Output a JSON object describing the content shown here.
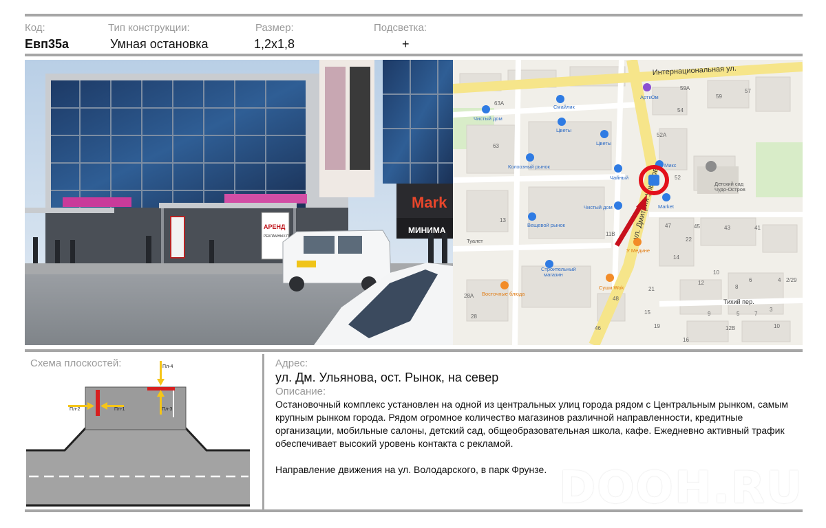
{
  "header": {
    "code_label": "Код:",
    "code_value": "Евп35а",
    "type_label": "Тип конструкции:",
    "type_value": "Умная остановка",
    "size_label": "Размер:",
    "size_value": "1,2х1,8",
    "light_label": "Подсветка:",
    "light_value": "+"
  },
  "photo": {
    "signs": {
      "market": "Mark",
      "minimum": "МИНИМА",
      "arenda": "АРЕНД",
      "arenda_sub": "РЕКЛАМНЫХ ПЛОСКОС"
    }
  },
  "map": {
    "streets": {
      "international": "Интернациональная ул.",
      "ulyanova": "ул. Дмитрия Ульянова",
      "tikhiy": "Тихий пер."
    },
    "places": {
      "artkom": "АрткОм",
      "smaylik": "Смайлик",
      "chisty_dom_1": "Чистый дом",
      "tsvety_1": "Цветы",
      "tsvety_2": "Цветы",
      "kolkhozny": "Колхозный рынок",
      "chayny": "Чайный",
      "miks": "Микс",
      "market": "Market",
      "detsad_1": "Детский сад",
      "detsad_2": "Чудо-Остров",
      "chisty_dom_2": "Чистый дом",
      "veshchevoy": "Вещевой рынок",
      "tualet": "Туалет",
      "u_medine": "У Медине",
      "stroitelny_1": "Строительный",
      "stroitelny_2": "магазин",
      "sushi": "Суши Wok",
      "vostochnye": "Восточные блюда"
    },
    "numbers": [
      "63А",
      "63",
      "59А",
      "59",
      "57",
      "54",
      "52А",
      "52",
      "13",
      "11В",
      "47",
      "45",
      "43",
      "41",
      "22",
      "14",
      "10",
      "12",
      "8",
      "6",
      "4",
      "2/29",
      "21",
      "48",
      "28А",
      "28",
      "19",
      "9",
      "5",
      "3",
      "10",
      "12В",
      "16",
      "46",
      "15",
      "7"
    ]
  },
  "schema": {
    "title": "Схема плоскостей:",
    "labels": {
      "pl1": "Пл-1",
      "pl2": "Пл-2",
      "pl3": "Пл-3",
      "pl4": "Пл-4"
    }
  },
  "info": {
    "address_label": "Адрес:",
    "address": "ул. Дм. Ульянова, ост. Рынок, на север",
    "description_label": "Описание:",
    "description": "Остановочный комплекс установлен на одной из центральных улиц города рядом с Центральным рынком, самым крупным рынком города. Рядом огромное количество магазинов различной направленности, кредитные организации, мобильные салоны, детский сад, общеобразовательная школа, кафе. Ежедневно активный трафик обеспечивает высокий уровень контакта с рекламой.",
    "direction": "Направление движения на ул. Володарского, в парк Фрунзе."
  },
  "watermark": "DOOH.RU",
  "colors": {
    "rule": "#a6a6a6",
    "label": "#9a9a9a",
    "marker": "#e3101b",
    "arrow": "#c8101c",
    "road_major": "#f6e58a",
    "poi_blue": "#2f7be3",
    "plane_red": "#d71f1f",
    "arrow_yellow": "#f5c518"
  }
}
